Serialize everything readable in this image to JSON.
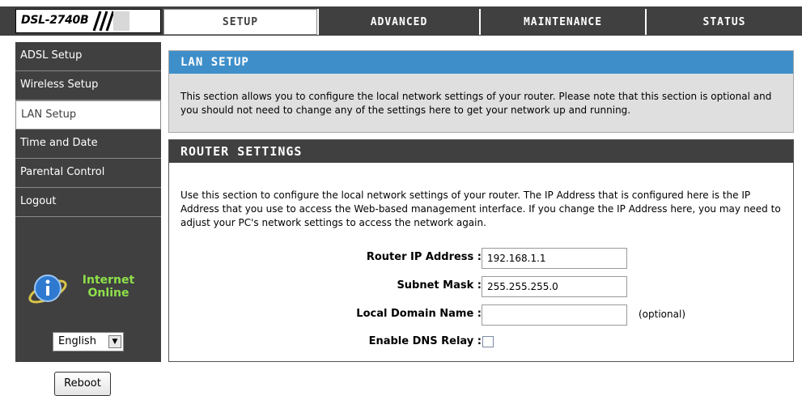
{
  "header": {
    "logo_text": "DSL-2740B",
    "tabs": [
      {
        "label": "SETUP"
      },
      {
        "label": "ADVANCED"
      },
      {
        "label": "MAINTENANCE"
      },
      {
        "label": "STATUS"
      }
    ]
  },
  "sidebar": {
    "items": [
      {
        "label": "ADSL Setup"
      },
      {
        "label": "Wireless Setup"
      },
      {
        "label": "LAN Setup"
      },
      {
        "label": "Time and Date"
      },
      {
        "label": "Parental Control"
      },
      {
        "label": "Logout"
      }
    ],
    "status_line1": "Internet",
    "status_line2": "Online",
    "language": "English",
    "reboot_label": "Reboot"
  },
  "lan_setup": {
    "title": "LAN SETUP",
    "description": "This section allows you to configure the local network settings of your router. Please note that this section is optional and you should not need to change any of the settings here to get your network up and running."
  },
  "router_settings": {
    "title": "ROUTER SETTINGS",
    "description": "Use this section to configure the local network settings of your router. The IP Address that is configured here is the IP Address that you use to access the Web-based management interface. If you change the IP Address here, you may need to adjust your PC's network settings to access the network again.",
    "fields": {
      "router_ip": {
        "label": "Router IP Address :",
        "value": "192.168.1.1"
      },
      "subnet_mask": {
        "label": "Subnet Mask :",
        "value": "255.255.255.0"
      },
      "domain_name": {
        "label": "Local Domain Name :",
        "value": "",
        "note": "(optional)"
      },
      "dns_relay": {
        "label": "Enable DNS Relay :",
        "checked": false
      }
    }
  },
  "colors": {
    "dark_bar": "#404040",
    "lan_title_blue": "#3e8fc9",
    "panel_gray": "#dfdfdf",
    "online_green": "#8ee04a"
  }
}
